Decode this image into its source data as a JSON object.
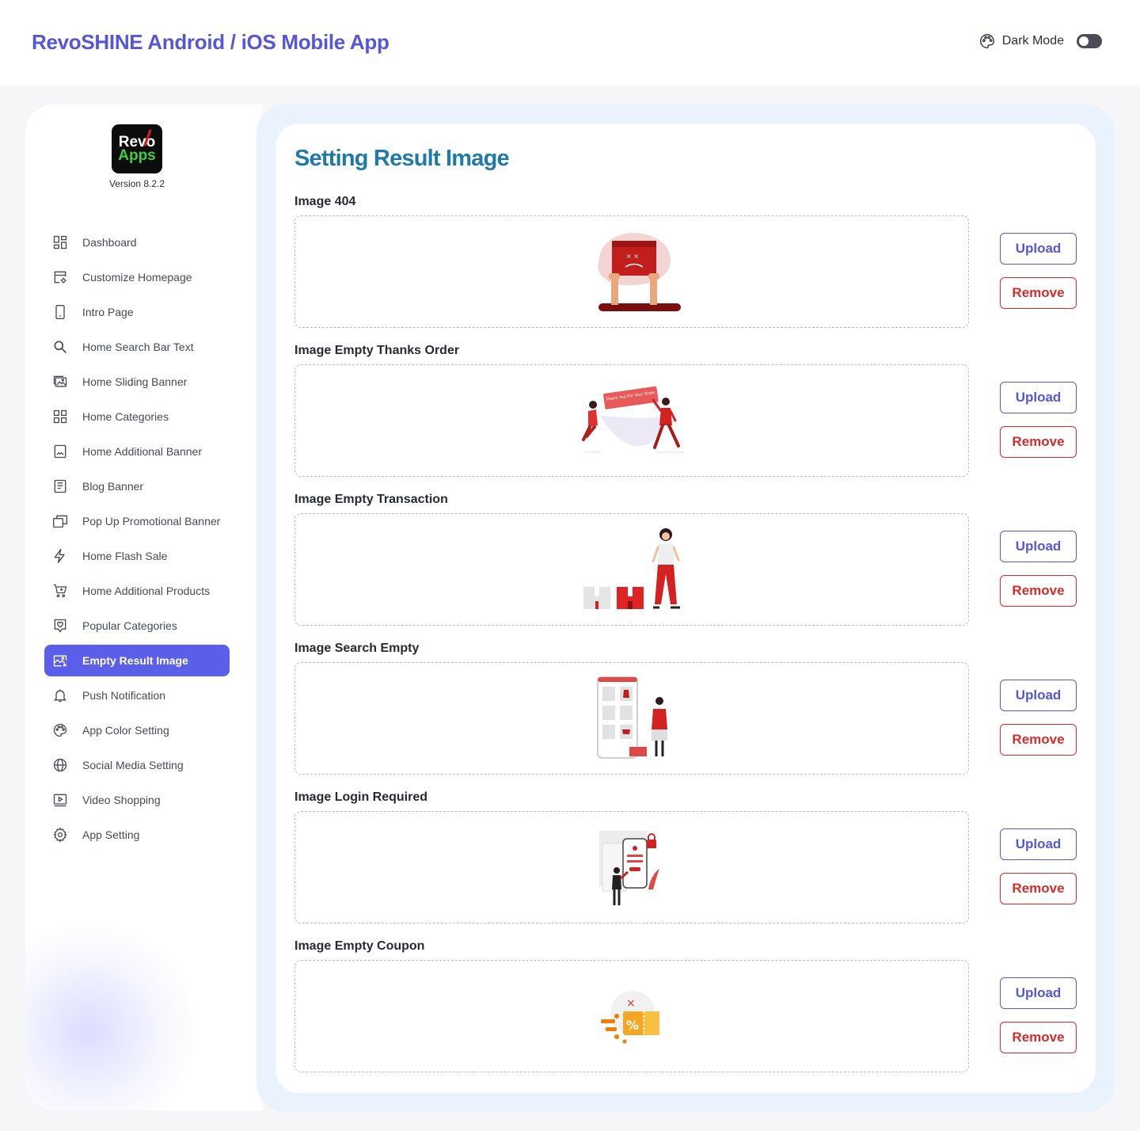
{
  "header": {
    "title": "RevoSHINE Android / iOS Mobile App",
    "dark_mode_label": "Dark Mode",
    "dark_mode_on": false
  },
  "sidebar": {
    "logo_line1": "Revo",
    "logo_line2": "Apps",
    "version": "Version 8.2.2",
    "items": [
      {
        "label": "Dashboard",
        "icon": "dashboard-icon",
        "active": false
      },
      {
        "label": "Customize Homepage",
        "icon": "customize-icon",
        "active": false
      },
      {
        "label": "Intro Page",
        "icon": "phone-icon",
        "active": false
      },
      {
        "label": "Home Search Bar Text",
        "icon": "search-icon",
        "active": false
      },
      {
        "label": "Home Sliding Banner",
        "icon": "images-icon",
        "active": false
      },
      {
        "label": "Home Categories",
        "icon": "grid-icon",
        "active": false
      },
      {
        "label": "Home Additional Banner",
        "icon": "image-icon",
        "active": false
      },
      {
        "label": "Blog Banner",
        "icon": "document-icon",
        "active": false
      },
      {
        "label": "Pop Up Promotional Banner",
        "icon": "popup-icon",
        "active": false
      },
      {
        "label": "Home Flash Sale",
        "icon": "lightning-icon",
        "active": false
      },
      {
        "label": "Home Additional Products",
        "icon": "cart-add-icon",
        "active": false
      },
      {
        "label": "Popular Categories",
        "icon": "heart-badge-icon",
        "active": false
      },
      {
        "label": "Empty Result Image",
        "icon": "image-x-icon",
        "active": true
      },
      {
        "label": "Push Notification",
        "icon": "bell-icon",
        "active": false
      },
      {
        "label": "App Color Setting",
        "icon": "palette-icon",
        "active": false
      },
      {
        "label": "Social Media Setting",
        "icon": "globe-icon",
        "active": false
      },
      {
        "label": "Video Shopping",
        "icon": "video-icon",
        "active": false
      },
      {
        "label": "App Setting",
        "icon": "gear-icon",
        "active": false
      }
    ]
  },
  "main": {
    "title": "Setting Result Image",
    "upload_label": "Upload",
    "remove_label": "Remove",
    "sections": [
      {
        "label": "Image 404",
        "illustration": "404-illustration"
      },
      {
        "label": "Image Empty Thanks Order",
        "illustration": "thanks-order-illustration",
        "banner_text": "Thank You For Your Order"
      },
      {
        "label": "Image Empty Transaction",
        "illustration": "empty-transaction-illustration"
      },
      {
        "label": "Image Search Empty",
        "illustration": "search-empty-illustration"
      },
      {
        "label": "Image Login Required",
        "illustration": "login-required-illustration"
      },
      {
        "label": "Image Empty Coupon",
        "illustration": "empty-coupon-illustration"
      }
    ]
  },
  "colors": {
    "brand": "#5557d6",
    "title_blue": "#1f7aa8",
    "active_menu": "#5b5ee8",
    "remove_red": "#d62b2b",
    "illustration_red": "#d82424"
  }
}
